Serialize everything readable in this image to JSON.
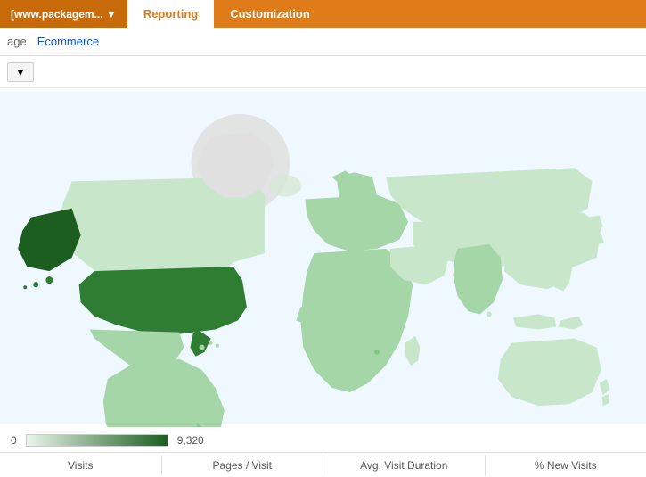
{
  "nav": {
    "brand_label": "[www.packagem... ▼",
    "items": [
      {
        "label": "Reporting",
        "active": true
      },
      {
        "label": "Customization",
        "active": false
      }
    ]
  },
  "sub_nav": {
    "items": [
      {
        "label": "age",
        "active": false
      },
      {
        "label": "Ecommerce",
        "active": true
      }
    ]
  },
  "toolbar": {
    "dropdown_label": "▼"
  },
  "legend": {
    "min_label": "0",
    "max_label": "9,320"
  },
  "stats": {
    "items": [
      {
        "label": "Visits"
      },
      {
        "label": "Pages / Visit"
      },
      {
        "label": "Avg. Visit Duration"
      },
      {
        "label": "% New Visits"
      }
    ]
  },
  "colors": {
    "nav_bg": "#e07b1a",
    "nav_active_text": "#e07b1a",
    "brand_bg": "#c96a0a",
    "map_light": "#c8e6c9",
    "map_medium": "#66bb6a",
    "map_dark": "#1b5e20",
    "map_usa": "#2e7d32",
    "map_alaska": "#1b5e20",
    "map_bg": "#f8f8f8"
  }
}
